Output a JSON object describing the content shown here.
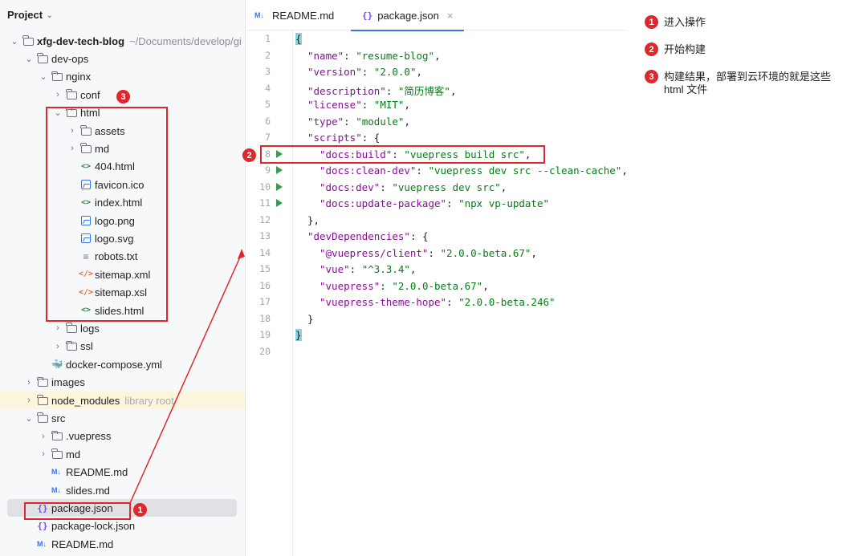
{
  "project": {
    "title": "Project",
    "tree": [
      {
        "label": "xfg-dev-tech-blog",
        "suffix": "~/Documents/develop/gi",
        "icon": "folder-icon",
        "arrow": "⌄"
      },
      {
        "label": "dev-ops",
        "icon": "folder-icon",
        "arrow": "⌄"
      },
      {
        "label": "nginx",
        "icon": "folder-icon",
        "arrow": "⌄"
      },
      {
        "label": "conf",
        "icon": "folder-icon",
        "arrow": "›"
      },
      {
        "label": "html",
        "icon": "folder-icon",
        "arrow": "⌄"
      },
      {
        "label": "assets",
        "icon": "folder-icon",
        "arrow": "›"
      },
      {
        "label": "md",
        "icon": "folder-icon",
        "arrow": "›"
      },
      {
        "label": "404.html",
        "icon": "html-file-icon",
        "glyph": "<>"
      },
      {
        "label": "favicon.ico",
        "icon": "image-file-icon"
      },
      {
        "label": "index.html",
        "icon": "html-file-icon",
        "glyph": "<>"
      },
      {
        "label": "logo.png",
        "icon": "image-file-icon"
      },
      {
        "label": "logo.svg",
        "icon": "image-file-icon"
      },
      {
        "label": "robots.txt",
        "icon": "text-file-icon",
        "glyph": "≡"
      },
      {
        "label": "sitemap.xml",
        "icon": "xml-file-icon",
        "glyph": "</>"
      },
      {
        "label": "sitemap.xsl",
        "icon": "xml-file-icon",
        "glyph": "</>"
      },
      {
        "label": "slides.html",
        "icon": "html-file-icon",
        "glyph": "<>"
      },
      {
        "label": "logs",
        "icon": "folder-icon",
        "arrow": "›"
      },
      {
        "label": "ssl",
        "icon": "folder-icon",
        "arrow": "›"
      },
      {
        "label": "docker-compose.yml",
        "icon": "docker-icon",
        "glyph": "🐳"
      },
      {
        "label": "images",
        "icon": "folder-icon",
        "arrow": "›"
      },
      {
        "label": "node_modules",
        "suffix": "library root",
        "icon": "folder-icon",
        "arrow": "›"
      },
      {
        "label": "src",
        "icon": "folder-icon",
        "arrow": "⌄"
      },
      {
        "label": ".vuepress",
        "icon": "folder-icon",
        "arrow": "›"
      },
      {
        "label": "md",
        "icon": "folder-icon",
        "arrow": "›"
      },
      {
        "label": "README.md",
        "icon": "markdown-file-icon",
        "glyph": "M↓"
      },
      {
        "label": "slides.md",
        "icon": "markdown-file-icon",
        "glyph": "M↓"
      },
      {
        "label": "package.json",
        "icon": "json-file-icon",
        "glyph": "{}"
      },
      {
        "label": "package-lock.json",
        "icon": "json-file-icon",
        "glyph": "{}"
      },
      {
        "label": "README.md",
        "icon": "markdown-file-icon",
        "glyph": "M↓"
      }
    ]
  },
  "editor": {
    "tabs": [
      {
        "label": "README.md",
        "icon_glyph": "M↓"
      },
      {
        "label": "package.json",
        "icon_glyph": "{}",
        "close": "×"
      }
    ],
    "line_numbers": [
      "1",
      "2",
      "3",
      "4",
      "5",
      "6",
      "7",
      "8",
      "9",
      "10",
      "11",
      "12",
      "13",
      "14",
      "15",
      "16",
      "17",
      "18",
      "19",
      "20"
    ],
    "code": [
      "{",
      "\"name\": \"resume-blog\",",
      "\"version\": \"2.0.0\",",
      "\"description\": \"简历博客\",",
      "\"license\": \"MIT\",",
      "\"type\": \"module\",",
      "\"scripts\": {",
      "\"docs:build\": \"vuepress build src\",",
      "\"docs:clean-dev\": \"vuepress dev src --clean-cache\",",
      "\"docs:dev\": \"vuepress dev src\",",
      "\"docs:update-package\": \"npx vp-update\"",
      "},",
      "\"devDependencies\": {",
      "\"@vuepress/client\": \"2.0.0-beta.67\",",
      "\"vue\": \"^3.3.4\",",
      "\"vuepress\": \"2.0.0-beta.67\",",
      "\"vuepress-theme-hope\": \"2.0.0-beta.246\"",
      "}",
      "}",
      ""
    ]
  },
  "annotations": {
    "badges": [
      "1",
      "2",
      "3"
    ],
    "callouts": [
      {
        "num": "1",
        "text": "进入操作"
      },
      {
        "num": "2",
        "text": "开始构建"
      },
      {
        "num": "3",
        "text": "构建结果，部署到云环境的就是这些html 文件"
      }
    ],
    "color": "#e0272b"
  }
}
